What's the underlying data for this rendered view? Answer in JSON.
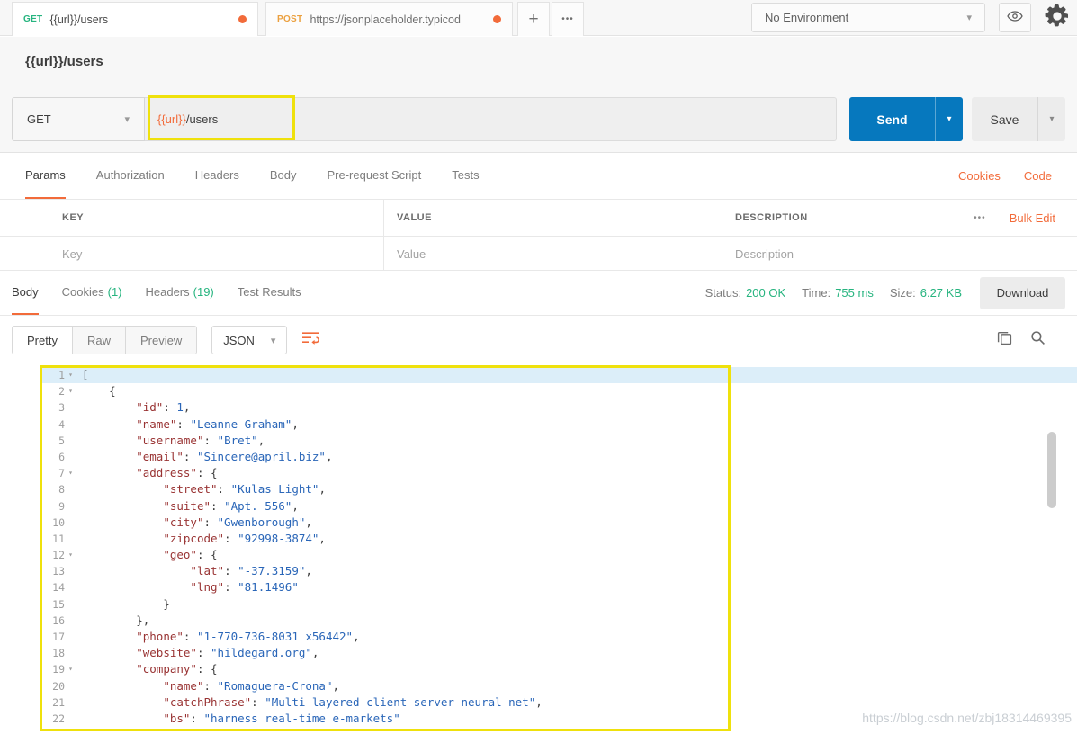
{
  "colors": {
    "accent_orange": "#F26B3A",
    "send_blue": "#0678BE",
    "method_get": "#26B47F",
    "method_post": "#EBA03F",
    "status_green": "#26B47F",
    "annotation_yellow": "#EFE10C",
    "json_key": "#993333",
    "json_string": "#2A66B8"
  },
  "topbar": {
    "tab1": {
      "method": "GET",
      "title": "{{url}}/users"
    },
    "tab2": {
      "method": "POST",
      "title": "https://jsonplaceholder.typicod"
    },
    "new_tab": "+",
    "more_tabs": "•••",
    "environment": "No Environment"
  },
  "request": {
    "name": "{{url}}/users",
    "method": "GET",
    "url_variable": "{{url}}",
    "url_path": "/users",
    "send": "Send",
    "save": "Save"
  },
  "request_tabs": [
    "Params",
    "Authorization",
    "Headers",
    "Body",
    "Pre-request Script",
    "Tests"
  ],
  "header_links": {
    "cookies": "Cookies",
    "code": "Code"
  },
  "params": {
    "columns": [
      "KEY",
      "VALUE",
      "DESCRIPTION"
    ],
    "more": "•••",
    "bulk_edit": "Bulk Edit",
    "placeholders": {
      "key": "Key",
      "value": "Value",
      "description": "Description"
    }
  },
  "response": {
    "tabs": {
      "body": "Body",
      "cookies": "Cookies",
      "cookies_count": "(1)",
      "headers": "Headers",
      "headers_count": "(19)",
      "test_results": "Test Results"
    },
    "status": {
      "label": "Status:",
      "value": "200 OK"
    },
    "time": {
      "label": "Time:",
      "value": "755 ms"
    },
    "size": {
      "label": "Size:",
      "value": "6.27 KB"
    },
    "download": "Download",
    "views": {
      "pretty": "Pretty",
      "raw": "Raw",
      "preview": "Preview",
      "language": "JSON"
    }
  },
  "code": {
    "lines": [
      {
        "n": 1,
        "fold": true,
        "active": true,
        "tokens": [
          [
            "p",
            "["
          ]
        ]
      },
      {
        "n": 2,
        "fold": true,
        "tokens": [
          [
            "p",
            "    {"
          ]
        ]
      },
      {
        "n": 3,
        "tokens": [
          [
            "p",
            "        "
          ],
          [
            "k",
            "\"id\""
          ],
          [
            "p",
            ": "
          ],
          [
            "num",
            "1"
          ],
          [
            "p",
            ","
          ]
        ]
      },
      {
        "n": 4,
        "tokens": [
          [
            "p",
            "        "
          ],
          [
            "k",
            "\"name\""
          ],
          [
            "p",
            ": "
          ],
          [
            "s",
            "\"Leanne Graham\""
          ],
          [
            "p",
            ","
          ]
        ]
      },
      {
        "n": 5,
        "tokens": [
          [
            "p",
            "        "
          ],
          [
            "k",
            "\"username\""
          ],
          [
            "p",
            ": "
          ],
          [
            "s",
            "\"Bret\""
          ],
          [
            "p",
            ","
          ]
        ]
      },
      {
        "n": 6,
        "tokens": [
          [
            "p",
            "        "
          ],
          [
            "k",
            "\"email\""
          ],
          [
            "p",
            ": "
          ],
          [
            "s",
            "\"Sincere@april.biz\""
          ],
          [
            "p",
            ","
          ]
        ]
      },
      {
        "n": 7,
        "fold": true,
        "tokens": [
          [
            "p",
            "        "
          ],
          [
            "k",
            "\"address\""
          ],
          [
            "p",
            ": {"
          ]
        ]
      },
      {
        "n": 8,
        "tokens": [
          [
            "p",
            "            "
          ],
          [
            "k",
            "\"street\""
          ],
          [
            "p",
            ": "
          ],
          [
            "s",
            "\"Kulas Light\""
          ],
          [
            "p",
            ","
          ]
        ]
      },
      {
        "n": 9,
        "tokens": [
          [
            "p",
            "            "
          ],
          [
            "k",
            "\"suite\""
          ],
          [
            "p",
            ": "
          ],
          [
            "s",
            "\"Apt. 556\""
          ],
          [
            "p",
            ","
          ]
        ]
      },
      {
        "n": 10,
        "tokens": [
          [
            "p",
            "            "
          ],
          [
            "k",
            "\"city\""
          ],
          [
            "p",
            ": "
          ],
          [
            "s",
            "\"Gwenborough\""
          ],
          [
            "p",
            ","
          ]
        ]
      },
      {
        "n": 11,
        "tokens": [
          [
            "p",
            "            "
          ],
          [
            "k",
            "\"zipcode\""
          ],
          [
            "p",
            ": "
          ],
          [
            "s",
            "\"92998-3874\""
          ],
          [
            "p",
            ","
          ]
        ]
      },
      {
        "n": 12,
        "fold": true,
        "tokens": [
          [
            "p",
            "            "
          ],
          [
            "k",
            "\"geo\""
          ],
          [
            "p",
            ": {"
          ]
        ]
      },
      {
        "n": 13,
        "tokens": [
          [
            "p",
            "                "
          ],
          [
            "k",
            "\"lat\""
          ],
          [
            "p",
            ": "
          ],
          [
            "s",
            "\"-37.3159\""
          ],
          [
            "p",
            ","
          ]
        ]
      },
      {
        "n": 14,
        "tokens": [
          [
            "p",
            "                "
          ],
          [
            "k",
            "\"lng\""
          ],
          [
            "p",
            ": "
          ],
          [
            "s",
            "\"81.1496\""
          ]
        ]
      },
      {
        "n": 15,
        "tokens": [
          [
            "p",
            "            }"
          ]
        ]
      },
      {
        "n": 16,
        "tokens": [
          [
            "p",
            "        },"
          ]
        ]
      },
      {
        "n": 17,
        "tokens": [
          [
            "p",
            "        "
          ],
          [
            "k",
            "\"phone\""
          ],
          [
            "p",
            ": "
          ],
          [
            "s",
            "\"1-770-736-8031 x56442\""
          ],
          [
            "p",
            ","
          ]
        ]
      },
      {
        "n": 18,
        "tokens": [
          [
            "p",
            "        "
          ],
          [
            "k",
            "\"website\""
          ],
          [
            "p",
            ": "
          ],
          [
            "s",
            "\"hildegard.org\""
          ],
          [
            "p",
            ","
          ]
        ]
      },
      {
        "n": 19,
        "fold": true,
        "tokens": [
          [
            "p",
            "        "
          ],
          [
            "k",
            "\"company\""
          ],
          [
            "p",
            ": {"
          ]
        ]
      },
      {
        "n": 20,
        "tokens": [
          [
            "p",
            "            "
          ],
          [
            "k",
            "\"name\""
          ],
          [
            "p",
            ": "
          ],
          [
            "s",
            "\"Romaguera-Crona\""
          ],
          [
            "p",
            ","
          ]
        ]
      },
      {
        "n": 21,
        "tokens": [
          [
            "p",
            "            "
          ],
          [
            "k",
            "\"catchPhrase\""
          ],
          [
            "p",
            ": "
          ],
          [
            "s",
            "\"Multi-layered client-server neural-net\""
          ],
          [
            "p",
            ","
          ]
        ]
      },
      {
        "n": 22,
        "tokens": [
          [
            "p",
            "            "
          ],
          [
            "k",
            "\"bs\""
          ],
          [
            "p",
            ": "
          ],
          [
            "s",
            "\"harness real-time e-markets\""
          ]
        ]
      }
    ]
  },
  "watermark": "https://blog.csdn.net/zbj18314469395"
}
